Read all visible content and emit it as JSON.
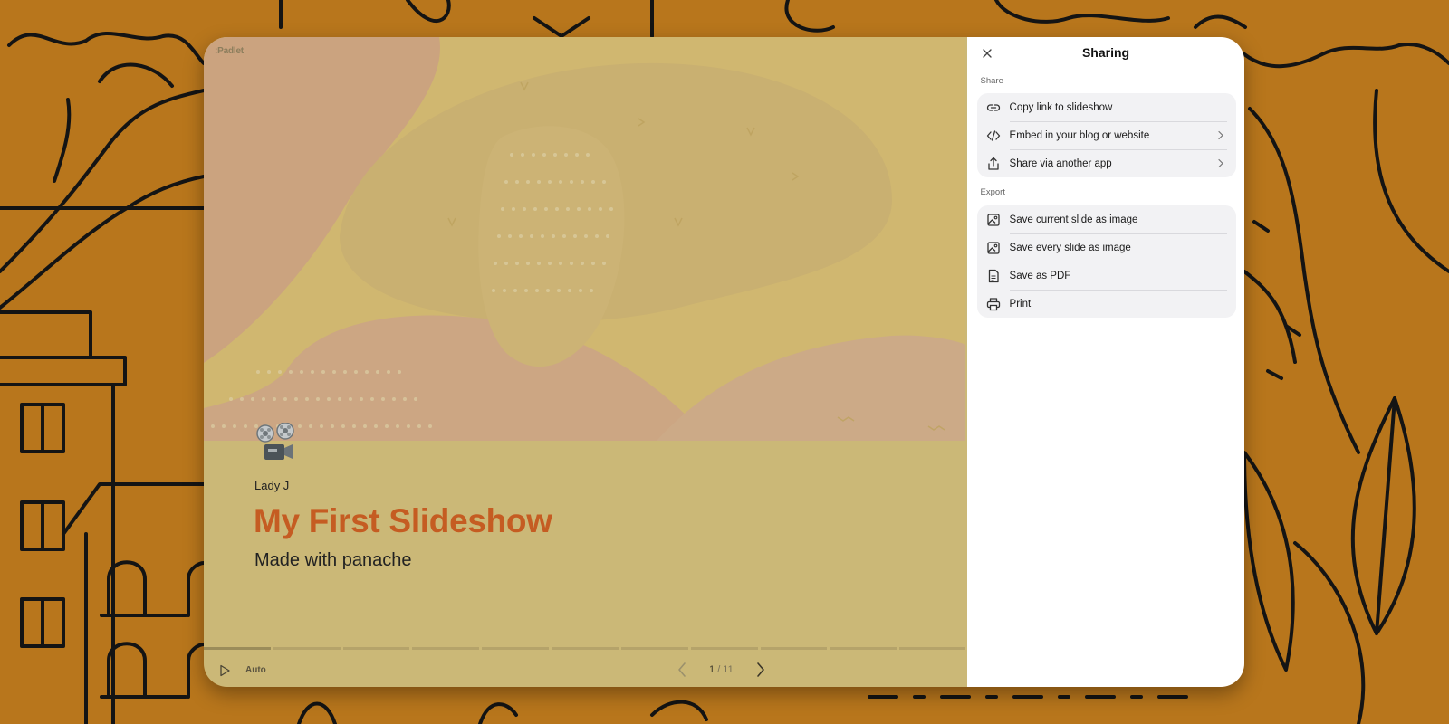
{
  "slide": {
    "logo_text": ":Padlet",
    "author": "Lady J",
    "title": "My First Slideshow",
    "subtitle": "Made with panache",
    "title_color": "#c55c22",
    "emoji_icon": "film-projector-icon"
  },
  "controls": {
    "auto_label": "Auto",
    "page_current": "1",
    "page_total": "/ 11",
    "progress_segments": 11,
    "active_segment": 1
  },
  "sharing": {
    "title": "Sharing",
    "share_section_label": "Share",
    "share_items": [
      {
        "label": "Copy link to slideshow",
        "icon": "link-icon",
        "chevron": false
      },
      {
        "label": "Embed in your blog or website",
        "icon": "code-icon",
        "chevron": true
      },
      {
        "label": "Share via another app",
        "icon": "share-icon",
        "chevron": true
      }
    ],
    "export_section_label": "Export",
    "export_items": [
      {
        "label": "Save current slide as image",
        "icon": "image-icon"
      },
      {
        "label": "Save every slide as image",
        "icon": "image-icon"
      },
      {
        "label": "Save as PDF",
        "icon": "pdf-icon"
      },
      {
        "label": "Print",
        "icon": "printer-icon"
      }
    ]
  },
  "colors": {
    "background": "#b8761c",
    "slide_background": "#cbb877",
    "panel_background": "#ffffff",
    "group_background": "#f2f2f4"
  }
}
